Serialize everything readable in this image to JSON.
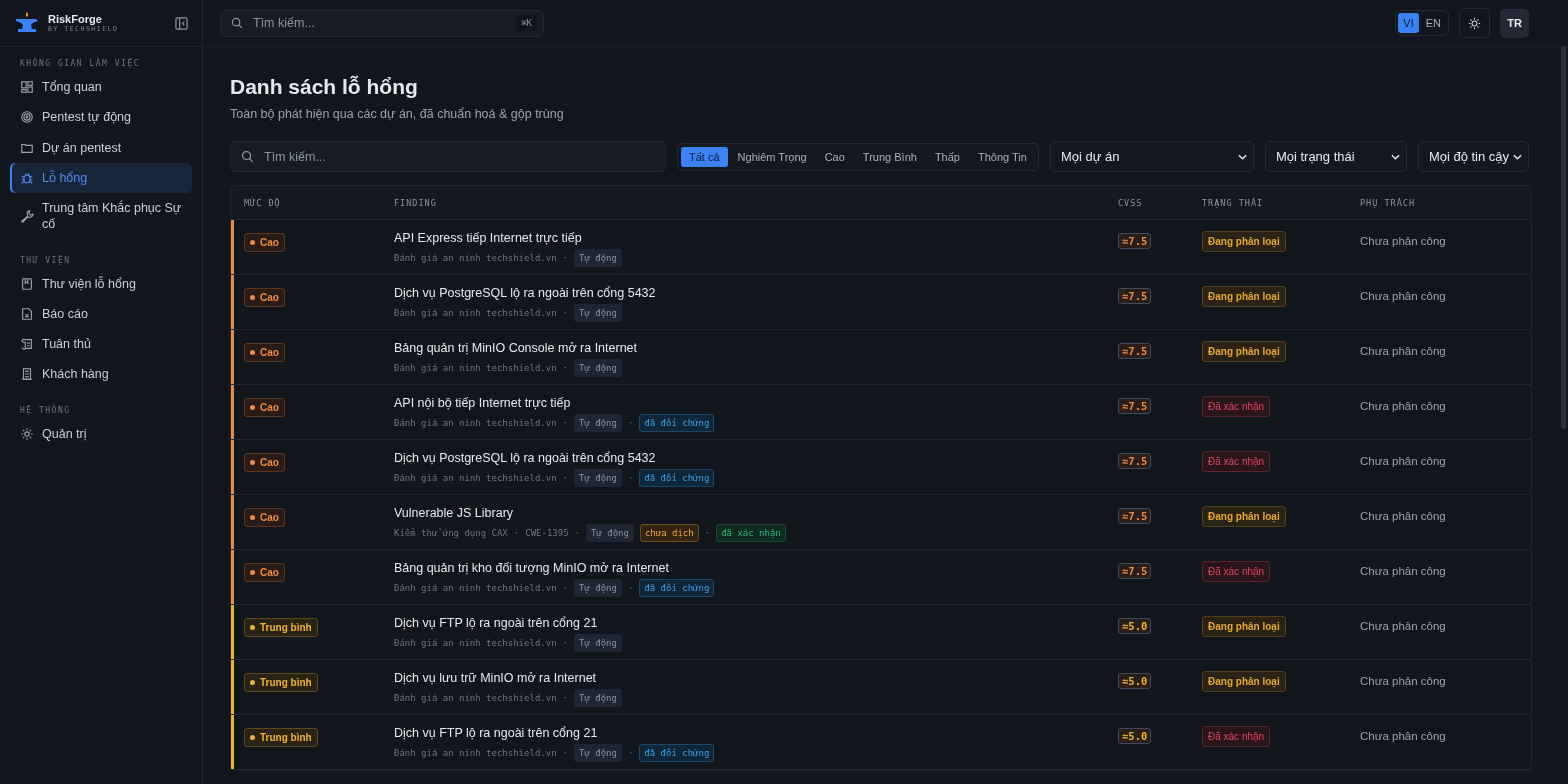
{
  "sidebar": {
    "brand": {
      "name": "RiskForge",
      "tagline": "BY TECHSHIELD"
    },
    "sections": [
      {
        "label": "KHÔNG GIAN LÀM VIỆC",
        "items": [
          {
            "label": "Tổng quan",
            "selected": false
          },
          {
            "label": "Pentest tự động",
            "selected": false
          },
          {
            "label": "Dự án pentest",
            "selected": false
          },
          {
            "label": "Lỗ hổng",
            "selected": true
          },
          {
            "label": "Trung tâm Khắc phục Sự cố",
            "selected": false
          }
        ]
      },
      {
        "label": "THƯ VIỆN",
        "items": [
          {
            "label": "Thư viện lỗ hổng",
            "selected": false
          },
          {
            "label": "Báo cáo",
            "selected": false
          },
          {
            "label": "Tuân thủ",
            "selected": false
          },
          {
            "label": "Khách hàng",
            "selected": false
          }
        ]
      },
      {
        "label": "HỆ THỐNG",
        "items": [
          {
            "label": "Quản trị",
            "selected": false
          }
        ]
      }
    ]
  },
  "topbar": {
    "search": {
      "placeholder": "Tìm kiếm...",
      "shortcut": "⌘K"
    },
    "languages": [
      {
        "label": "VI",
        "selected": true
      },
      {
        "label": "EN",
        "selected": false
      }
    ],
    "avatar": "TR"
  },
  "page": {
    "title": "Danh sách lỗ hổng",
    "subtitle": "Toàn bộ phát hiện qua các dự án, đã chuẩn hoá & gộp trùng"
  },
  "filters": {
    "search": {
      "placeholder": "Tìm kiếm..."
    },
    "severity_tabs": [
      {
        "label": "Tất cả",
        "selected": true
      },
      {
        "label": "Nghiêm Trọng",
        "selected": false
      },
      {
        "label": "Cao",
        "selected": false
      },
      {
        "label": "Trung Bình",
        "selected": false
      },
      {
        "label": "Thấp",
        "selected": false
      },
      {
        "label": "Thông Tin",
        "selected": false
      }
    ],
    "dropdowns": [
      {
        "value": "Mọi dự án"
      },
      {
        "value": "Mọi trạng thái"
      },
      {
        "value": "Mọi độ tin cậy"
      }
    ]
  },
  "table": {
    "columns": [
      "MỨC ĐỘ",
      "FINDING",
      "CVSS",
      "TRẠNG THÁI",
      "PHỤ TRÁCH"
    ],
    "rows": [
      {
        "severity": {
          "kind": "high",
          "label": "Cao"
        },
        "title": "API Express tiếp Internet trực tiếp",
        "meta": [
          {
            "kind": "text",
            "text": "Đánh giá an ninh techshield.vn"
          },
          {
            "kind": "sep",
            "text": "·"
          },
          {
            "kind": "auto",
            "text": "Tự động"
          }
        ],
        "cvss": "≈7.5",
        "status": {
          "kind": "triage",
          "label": "Đang phân loại"
        },
        "assignee": "Chưa phân công"
      },
      {
        "severity": {
          "kind": "high",
          "label": "Cao"
        },
        "title": "Dịch vụ PostgreSQL lộ ra ngoài trên cổng 5432",
        "meta": [
          {
            "kind": "text",
            "text": "Đánh giá an ninh techshield.vn"
          },
          {
            "kind": "sep",
            "text": "·"
          },
          {
            "kind": "auto",
            "text": "Tự động"
          }
        ],
        "cvss": "≈7.5",
        "status": {
          "kind": "triage",
          "label": "Đang phân loại"
        },
        "assignee": "Chưa phân công"
      },
      {
        "severity": {
          "kind": "high",
          "label": "Cao"
        },
        "title": "Bảng quản trị MinIO Console mở ra Internet",
        "meta": [
          {
            "kind": "text",
            "text": "Đánh giá an ninh techshield.vn"
          },
          {
            "kind": "sep",
            "text": "·"
          },
          {
            "kind": "auto",
            "text": "Tự động"
          }
        ],
        "cvss": "≈7.5",
        "status": {
          "kind": "triage",
          "label": "Đang phân loại"
        },
        "assignee": "Chưa phân công"
      },
      {
        "severity": {
          "kind": "high",
          "label": "Cao"
        },
        "title": "API nội bộ tiếp Internet trực tiếp",
        "meta": [
          {
            "kind": "text",
            "text": "Đánh giá an ninh techshield.vn"
          },
          {
            "kind": "sep",
            "text": "·"
          },
          {
            "kind": "auto",
            "text": "Tự động"
          },
          {
            "kind": "sep",
            "text": "·"
          },
          {
            "kind": "reconciled",
            "text": "đã đối chứng"
          }
        ],
        "cvss": "≈7.5",
        "status": {
          "kind": "confirmed",
          "label": "Đã xác nhận"
        },
        "assignee": "Chưa phân công"
      },
      {
        "severity": {
          "kind": "high",
          "label": "Cao"
        },
        "title": "Dịch vụ PostgreSQL lộ ra ngoài trên cổng 5432",
        "meta": [
          {
            "kind": "text",
            "text": "Đánh giá an ninh techshield.vn"
          },
          {
            "kind": "sep",
            "text": "·"
          },
          {
            "kind": "auto",
            "text": "Tự động"
          },
          {
            "kind": "sep",
            "text": "·"
          },
          {
            "kind": "reconciled",
            "text": "đã đối chứng"
          }
        ],
        "cvss": "≈7.5",
        "status": {
          "kind": "confirmed",
          "label": "Đã xác nhận"
        },
        "assignee": "Chưa phân công"
      },
      {
        "severity": {
          "kind": "high",
          "label": "Cao"
        },
        "title": "Vulnerable JS Library",
        "meta": [
          {
            "kind": "text",
            "text": "Kiểm thử ứng dụng CAX"
          },
          {
            "kind": "sep",
            "text": "·"
          },
          {
            "kind": "text",
            "text": "CWE-1395"
          },
          {
            "kind": "sep",
            "text": "·"
          },
          {
            "kind": "auto",
            "text": "Tự động"
          },
          {
            "kind": "untranslated",
            "text": "chưa dịch"
          },
          {
            "kind": "sep",
            "text": "·"
          },
          {
            "kind": "verified",
            "text": "đã xác nhận"
          }
        ],
        "cvss": "≈7.5",
        "status": {
          "kind": "triage",
          "label": "Đang phân loại"
        },
        "assignee": "Chưa phân công"
      },
      {
        "severity": {
          "kind": "high",
          "label": "Cao"
        },
        "title": "Bảng quản trị kho đối tượng MinIO mở ra Internet",
        "meta": [
          {
            "kind": "text",
            "text": "Đánh giá an ninh techshield.vn"
          },
          {
            "kind": "sep",
            "text": "·"
          },
          {
            "kind": "auto",
            "text": "Tự động"
          },
          {
            "kind": "sep",
            "text": "·"
          },
          {
            "kind": "reconciled",
            "text": "đã đối chứng"
          }
        ],
        "cvss": "≈7.5",
        "status": {
          "kind": "confirmed",
          "label": "Đã xác nhận"
        },
        "assignee": "Chưa phân công"
      },
      {
        "severity": {
          "kind": "medium",
          "label": "Trung bình"
        },
        "title": "Dịch vụ FTP lộ ra ngoài trên cổng 21",
        "meta": [
          {
            "kind": "text",
            "text": "Đánh giá an ninh techshield.vn"
          },
          {
            "kind": "sep",
            "text": "·"
          },
          {
            "kind": "auto",
            "text": "Tự động"
          }
        ],
        "cvss": "≈5.0",
        "status": {
          "kind": "triage",
          "label": "Đang phân loại"
        },
        "assignee": "Chưa phân công"
      },
      {
        "severity": {
          "kind": "medium",
          "label": "Trung bình"
        },
        "title": "Dịch vụ lưu trữ MinIO mở ra Internet",
        "meta": [
          {
            "kind": "text",
            "text": "Đánh giá an ninh techshield.vn"
          },
          {
            "kind": "sep",
            "text": "·"
          },
          {
            "kind": "auto",
            "text": "Tự động"
          }
        ],
        "cvss": "≈5.0",
        "status": {
          "kind": "triage",
          "label": "Đang phân loại"
        },
        "assignee": "Chưa phân công"
      },
      {
        "severity": {
          "kind": "medium",
          "label": "Trung bình"
        },
        "title": "Dịch vụ FTP lộ ra ngoài trên cổng 21",
        "meta": [
          {
            "kind": "text",
            "text": "Đánh giá an ninh techshield.vn"
          },
          {
            "kind": "sep",
            "text": "·"
          },
          {
            "kind": "auto",
            "text": "Tự động"
          },
          {
            "kind": "sep",
            "text": "·"
          },
          {
            "kind": "reconciled",
            "text": "đã đối chứng"
          }
        ],
        "cvss": "≈5.0",
        "status": {
          "kind": "confirmed",
          "label": "Đã xác nhận"
        },
        "assignee": "Chưa phân công"
      }
    ]
  }
}
